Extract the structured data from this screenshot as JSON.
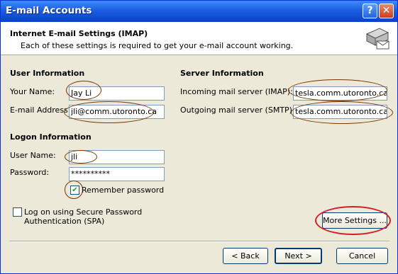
{
  "window": {
    "title": "E-mail Accounts"
  },
  "header": {
    "title": "Internet E-mail Settings (IMAP)",
    "subtitle": "Each of these settings is required to get your e-mail account working."
  },
  "user_info": {
    "heading": "User Information",
    "your_name_label": "Your Name:",
    "your_name_value": "Jay Li",
    "email_label": "E-mail Address:",
    "email_value": "jli@comm.utoronto.ca"
  },
  "server_info": {
    "heading": "Server Information",
    "incoming_label": "Incoming mail server (IMAP):",
    "incoming_value": "tesla.comm.utoronto.ca",
    "outgoing_label": "Outgoing mail server (SMTP):",
    "outgoing_value": "tesla.comm.utoronto.ca"
  },
  "logon_info": {
    "heading": "Logon Information",
    "username_label": "User Name:",
    "username_value": "jli",
    "password_label": "Password:",
    "password_value": "**********",
    "remember_label": "Remember password",
    "remember_checked": true,
    "spa_label_line1": "Log on using Secure Password",
    "spa_label_line2": "Authentication (SPA)",
    "spa_checked": false
  },
  "buttons": {
    "more_settings": "More Settings ...",
    "back": "< Back",
    "next": "Next >",
    "cancel": "Cancel"
  },
  "title_buttons": {
    "help": "?",
    "close": "✕"
  },
  "colors": {
    "titlebar": "#0a3fcc",
    "annotation": "#7a3700",
    "annotation_red": "#d0202a"
  }
}
